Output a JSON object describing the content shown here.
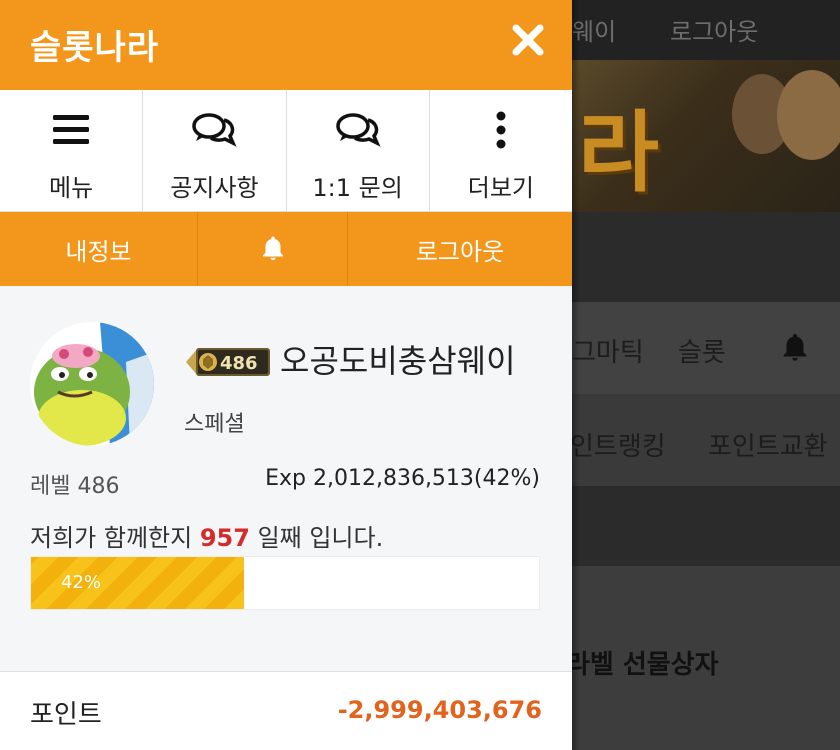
{
  "background": {
    "top_links": [
      "웨이",
      "로그아웃"
    ],
    "banner_text": "라",
    "band1_items": [
      "그마틱",
      "슬롯"
    ],
    "band2_items": [
      "인트랭킹",
      "포인트교환"
    ],
    "gift_text": "라벨 선물상자"
  },
  "panel": {
    "title": "슬롯나라",
    "nav": [
      {
        "label": "메뉴",
        "icon": "hamburger-icon"
      },
      {
        "label": "공지사항",
        "icon": "chat-bubbles-icon"
      },
      {
        "label": "1:1 문의",
        "icon": "chat-bubbles-icon"
      },
      {
        "label": "더보기",
        "icon": "vertical-dots-icon"
      }
    ],
    "subbar": {
      "my_info": "내정보",
      "bell_icon": "bell-icon",
      "logout": "로그아웃"
    },
    "profile": {
      "level_badge": "486",
      "nickname": "오공도비충삼웨이",
      "grade": "스페셜",
      "level_label": "레벨 486",
      "exp": "Exp 2,012,836,513(42%)",
      "days_prefix": "저희가 함께한지 ",
      "days_count": "957",
      "days_suffix": " 일째 입니다.",
      "progress_percent": 42,
      "progress_label": "42%"
    },
    "points": {
      "label": "포인트",
      "value": "-2,999,403,676"
    }
  },
  "colors": {
    "accent": "#f2961c",
    "points_value": "#e2631d",
    "days_highlight": "#d42b2b",
    "progress": "#f7c21a"
  }
}
